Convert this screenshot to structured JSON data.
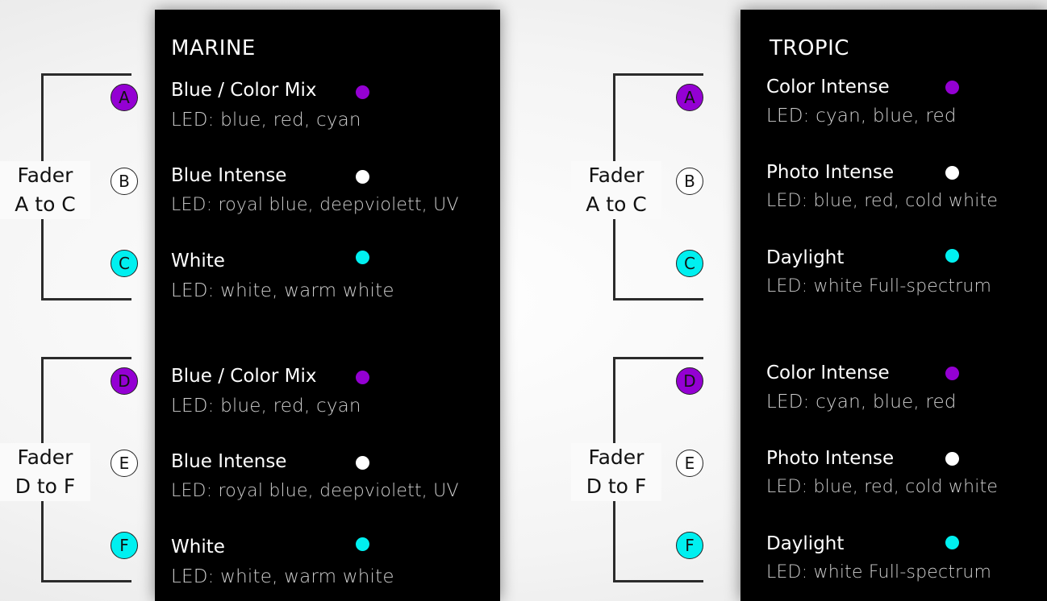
{
  "marine": {
    "title": "MARINE",
    "channels": [
      {
        "letter": "A",
        "name": "Blue / Color Mix",
        "led": "LED: blue, red, cyan",
        "color": "#9400d3"
      },
      {
        "letter": "B",
        "name": "Blue Intense",
        "led": "LED: royal blue, deepviolett, UV",
        "color": "#ffffff"
      },
      {
        "letter": "C",
        "name": "White",
        "led": "LED: white, warm white",
        "color": "#00f0f0"
      },
      {
        "letter": "D",
        "name": "Blue / Color Mix",
        "led": "LED: blue, red, cyan",
        "color": "#9400d3"
      },
      {
        "letter": "E",
        "name": "Blue Intense",
        "led": "LED: royal blue, deepviolett, UV",
        "color": "#ffffff"
      },
      {
        "letter": "F",
        "name": "White",
        "led": "LED: white, warm white",
        "color": "#00f0f0"
      }
    ],
    "fader_1": {
      "line1": "Fader",
      "line2": "A to C"
    },
    "fader_2": {
      "line1": "Fader",
      "line2": "D to F"
    }
  },
  "tropic": {
    "title": "TROPIC",
    "channels": [
      {
        "letter": "A",
        "name": "Color Intense",
        "led": "LED: cyan, blue, red",
        "color": "#9400d3"
      },
      {
        "letter": "B",
        "name": "Photo Intense",
        "led": "LED: blue, red, cold white",
        "color": "#ffffff"
      },
      {
        "letter": "C",
        "name": "Daylight",
        "led": "LED: white Full-spectrum",
        "color": "#00f0f0"
      },
      {
        "letter": "D",
        "name": "Color Intense",
        "led": "LED: cyan, blue, red",
        "color": "#9400d3"
      },
      {
        "letter": "E",
        "name": "Photo Intense",
        "led": "LED: blue, red, cold white",
        "color": "#ffffff"
      },
      {
        "letter": "F",
        "name": "Daylight",
        "led": "LED: white Full-spectrum",
        "color": "#00f0f0"
      }
    ],
    "fader_1": {
      "line1": "Fader",
      "line2": "A to C"
    },
    "fader_2": {
      "line1": "Fader",
      "line2": "D to F"
    }
  }
}
